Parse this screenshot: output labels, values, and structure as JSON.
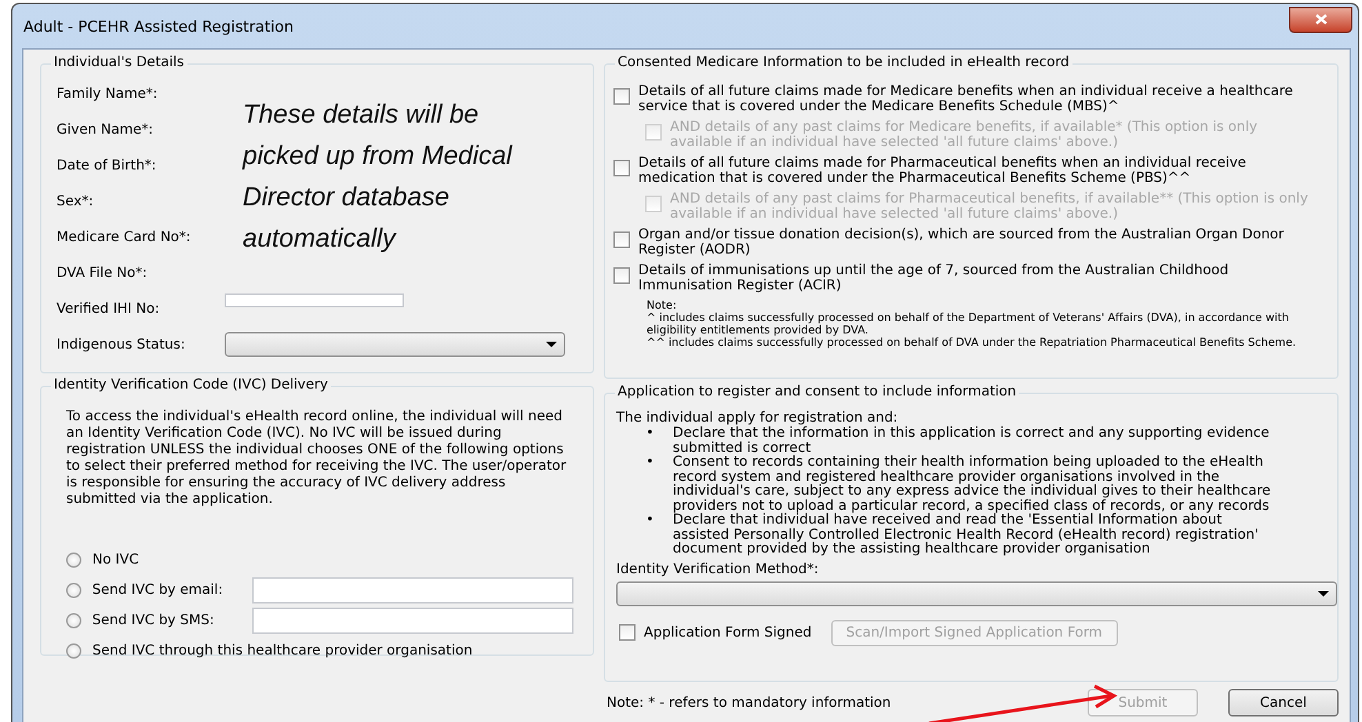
{
  "window": {
    "title": "Adult - PCEHR Assisted Registration"
  },
  "individual_details": {
    "title": "Individual's Details",
    "fields": [
      {
        "label": "Family Name*:",
        "kind": "label"
      },
      {
        "label": "Given Name*:",
        "kind": "label"
      },
      {
        "label": "Date of Birth*:",
        "kind": "label"
      },
      {
        "label": "Sex*:",
        "kind": "label"
      },
      {
        "label": "Medicare Card No*:",
        "kind": "label"
      },
      {
        "label": "DVA File No*:",
        "kind": "label"
      },
      {
        "label": "Verified IHI No:",
        "kind": "text"
      },
      {
        "label": "Indigenous Status:",
        "kind": "select"
      }
    ],
    "overlay_note": "These details will be picked up from Medical Director database automatically"
  },
  "ivc": {
    "title": "Identity Verification Code (IVC) Delivery",
    "description": "To access the individual's eHealth record online, the individual will need an Identity Verification Code (IVC). No IVC will be issued during registration UNLESS the individual chooses ONE of the following options to select their preferred method for receiving the IVC. The user/operator is responsible for ensuring the accuracy of IVC delivery address submitted via the application.",
    "options": [
      {
        "label": "No IVC",
        "kind": "plain",
        "selected": false
      },
      {
        "label": "Send IVC by email:",
        "kind": "field",
        "selected": false
      },
      {
        "label": "Send IVC by SMS:",
        "kind": "field",
        "selected": false
      },
      {
        "label": "Send IVC through this healthcare provider organisation",
        "kind": "plain",
        "selected": false
      }
    ]
  },
  "consent": {
    "title": "Consented Medicare Information to be included in eHealth record",
    "items": [
      {
        "text": "Details of all future claims made for Medicare benefits when an individual receive a healthcare service  that is covered under the Medicare Benefits Schedule (MBS)^",
        "checked": false,
        "disabled": false,
        "children": [
          {
            "text": "AND details of any past claims for Medicare benefits, if available* (This option is only available if an individual have selected 'all future claims' above.)",
            "checked": false,
            "disabled": true
          }
        ]
      },
      {
        "text": "Details of all future claims made for Pharmaceutical benefits when an individual receive medication that is covered under the Pharmaceutical Benefits Scheme (PBS)^^",
        "checked": false,
        "disabled": false,
        "children": [
          {
            "text": "AND details of any past claims for Pharmaceutical benefits, if available** (This option is only available if an individual have selected 'all future claims' above.)",
            "checked": false,
            "disabled": true
          }
        ]
      },
      {
        "text": "Organ and/or tissue donation decision(s), which are sourced from the Australian Organ Donor Register (AODR)",
        "checked": false,
        "disabled": false
      },
      {
        "text": "Details of immunisations up until the age of 7, sourced from the Australian Childhood Immunisation Register (ACIR)",
        "checked": false,
        "disabled": false
      }
    ],
    "notes": [
      "Note:",
      "^ includes claims successfully processed on behalf of the Department of Veterans' Affairs (DVA), in accordance with eligibility entitlements provided by DVA.",
      "^^ includes claims successfully processed on behalf of DVA under the Repatriation Pharmaceutical Benefits Scheme."
    ]
  },
  "application": {
    "title": "Application to register and consent to include information",
    "intro": "The individual apply for registration and:",
    "bullets": [
      "Declare that the information in this application is correct and any supporting evidence submitted is correct",
      "Consent to records containing their health information being uploaded to the eHealth record system and registered healthcare provider organisations involved in the individual's care, subject to any express advice the individual gives to their healthcare providers not to upload a particular record, a specified class of records, or any records",
      "Declare that individual have received and read the 'Essential Information about assisted Personally Controlled Electronic Health Record (eHealth record) registration' document provided by the assisting healthcare provider organisation"
    ],
    "bullet_mark": "•",
    "verification_label": "Identity Verification Method*:",
    "signed": {
      "label": "Application Form Signed",
      "checked": false
    },
    "scan_button": {
      "label": "Scan/Import Signed Application Form",
      "disabled": true
    }
  },
  "footer": {
    "note": "Note: * - refers to mandatory information",
    "buttons": [
      {
        "label": "Submit",
        "disabled": true
      },
      {
        "label": "Cancel",
        "disabled": false
      }
    ]
  }
}
